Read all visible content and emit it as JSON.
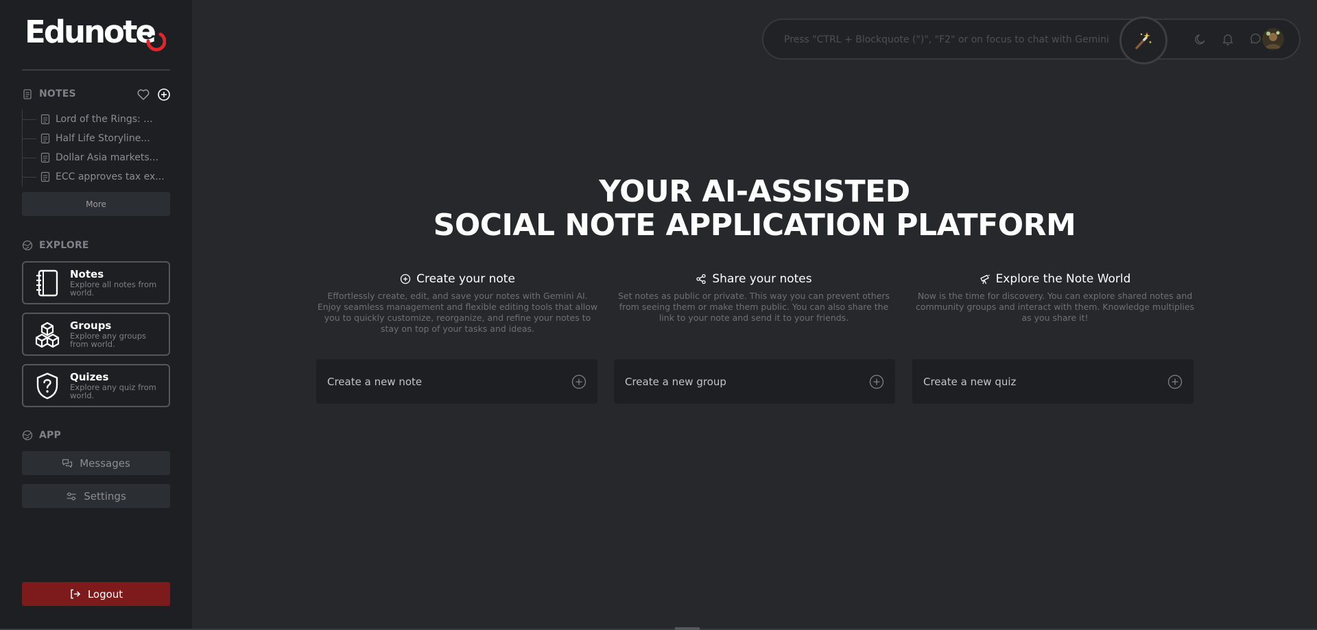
{
  "brand": {
    "name": "Edunote",
    "swoosh_color": "#e0252b"
  },
  "sidebar": {
    "notes_section": {
      "title": "NOTES",
      "items": [
        {
          "label": "Lord of the Rings: ..."
        },
        {
          "label": "Half Life Storyline..."
        },
        {
          "label": "Dollar Asia markets..."
        },
        {
          "label": "ECC approves tax ex..."
        }
      ],
      "more_label": "More"
    },
    "explore_section": {
      "title": "EXPLORE",
      "cards": [
        {
          "title": "Notes",
          "desc": "Explore all notes from world."
        },
        {
          "title": "Groups",
          "desc": "Explore any groups from world."
        },
        {
          "title": "Quizes",
          "desc": "Explore any quiz from world."
        }
      ]
    },
    "app_section": {
      "title": "APP",
      "messages_label": "Messages",
      "settings_label": "Settings"
    },
    "logout_label": "Logout"
  },
  "topbar": {
    "search_placeholder": "Press \"CTRL + Blockquote (\")\", \"F2\" or on focus to chat with Gemini"
  },
  "hero": {
    "line1": "YOUR AI-ASSISTED",
    "line2": "SOCIAL NOTE APPLICATION PLATFORM"
  },
  "features": [
    {
      "title": "Create your note",
      "desc": "Effortlessly create, edit, and save your notes with Gemini AI. Enjoy seamless management and flexible editing tools that allow you to quickly customize, reorganize, and refine your notes to stay on top of your tasks and ideas."
    },
    {
      "title": "Share your notes",
      "desc": "Set notes as public or private. This way you can prevent others from seeing them or make them public. You can also share the link to your note and send it to your friends."
    },
    {
      "title": "Explore the Note World",
      "desc": "Now is the time for discovery. You can explore shared notes and community groups and interact with them. Knowledge multiplies as you share it!"
    }
  ],
  "create_actions": [
    {
      "label": "Create a new note"
    },
    {
      "label": "Create a new group"
    },
    {
      "label": "Create a new quiz"
    }
  ],
  "colors": {
    "background": "#26282c",
    "sidebar": "#1d1f22",
    "logout": "#7d1a1c"
  }
}
